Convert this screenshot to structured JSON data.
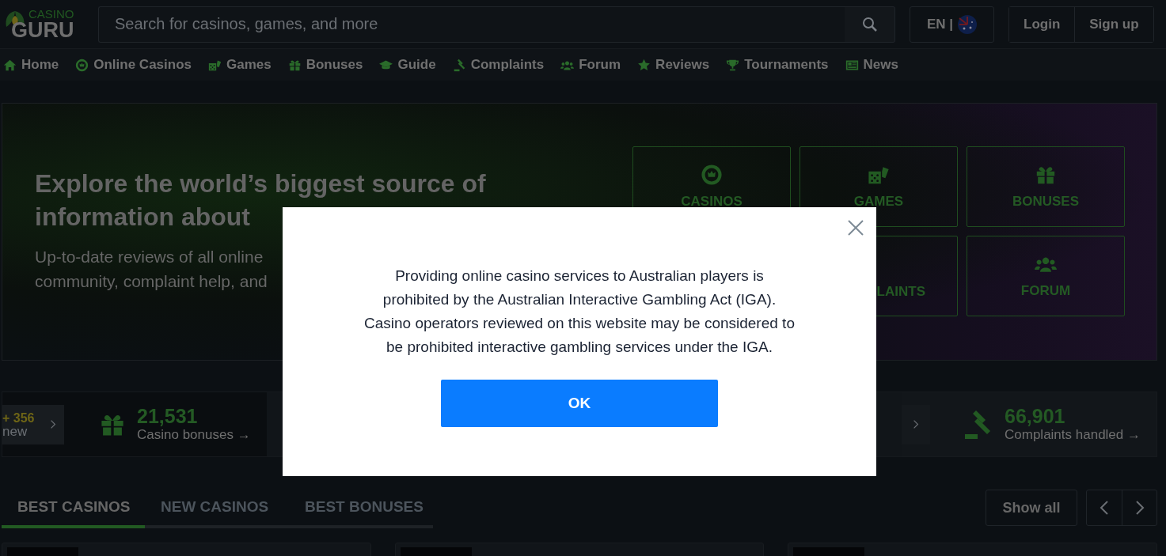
{
  "logo": {
    "top": "CASINO",
    "bottom": "GURU"
  },
  "search": {
    "placeholder": "Search for casinos, games, and more"
  },
  "language": {
    "label": "EN |"
  },
  "auth": [
    "Login",
    "Sign up"
  ],
  "nav": [
    {
      "label": "Home",
      "kind": "home"
    },
    {
      "label": "Online Casinos",
      "kind": "chip"
    },
    {
      "label": "Games",
      "kind": "dice"
    },
    {
      "label": "Bonuses",
      "kind": "gift"
    },
    {
      "label": "Guide",
      "kind": "cap"
    },
    {
      "label": "Complaints",
      "kind": "gavel"
    },
    {
      "label": "Forum",
      "kind": "users"
    },
    {
      "label": "Reviews",
      "kind": "star"
    },
    {
      "label": "Tournaments",
      "kind": "trophy"
    },
    {
      "label": "News",
      "kind": "news"
    }
  ],
  "hero": {
    "heading": [
      "Explore the world’s biggest source of",
      "information about"
    ],
    "text": [
      "Up-to-date reviews of all online",
      "community, complaint help, and"
    ],
    "tiles": [
      {
        "label": "CASINOS",
        "kind": "chip"
      },
      {
        "label": "GAMES",
        "kind": "dice"
      },
      {
        "label": "BONUSES",
        "kind": "gift"
      },
      {
        "label": "LAINTS",
        "kind": "partial"
      },
      {
        "label": "FORUM",
        "kind": "users"
      }
    ]
  },
  "stats": {
    "new_badge": {
      "count": "+ 356",
      "label": "new"
    },
    "items": [
      {
        "value": "21,531",
        "label": "Casino bonuses →",
        "kind": "gift"
      },
      {
        "value": "66,901",
        "label": "Complaints handled →",
        "kind": "gavel"
      }
    ]
  },
  "tabs": [
    {
      "label": "BEST CASINOS",
      "selected": true
    },
    {
      "label": "NEW CASINOS",
      "selected": false
    },
    {
      "label": "BEST BONUSES",
      "selected": false
    }
  ],
  "show_all": "Show all",
  "modal": {
    "text": "Providing online casino services to Australian players is prohibited by the Australian Interactive Gambling Act (IGA). Casino operators reviewed on this website may be considered to be prohibited interactive gambling services under the IGA.",
    "button": "OK"
  }
}
